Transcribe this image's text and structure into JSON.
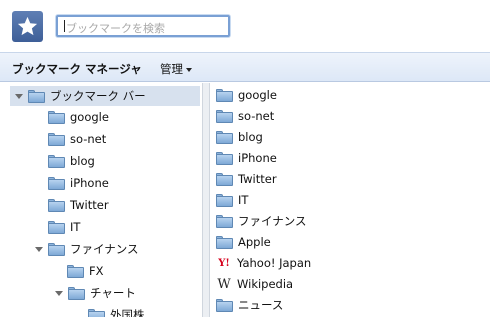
{
  "header": {
    "logo_icon": "star-icon",
    "search_placeholder": "ブックマークを検索"
  },
  "toolbar": {
    "title": "ブックマーク マネージャ",
    "organize_label": "管理"
  },
  "tree": {
    "root": "ブックマーク バー",
    "items": [
      "google",
      "so-net",
      "blog",
      "iPhone",
      "Twitter",
      "IT",
      "ファイナンス",
      "FX",
      "チャート",
      "外国株"
    ]
  },
  "list": {
    "items": [
      {
        "label": "google",
        "icon": "folder-icon"
      },
      {
        "label": "so-net",
        "icon": "folder-icon"
      },
      {
        "label": "blog",
        "icon": "folder-icon"
      },
      {
        "label": "iPhone",
        "icon": "folder-icon"
      },
      {
        "label": "Twitter",
        "icon": "folder-icon"
      },
      {
        "label": "IT",
        "icon": "folder-icon"
      },
      {
        "label": "ファイナンス",
        "icon": "folder-icon"
      },
      {
        "label": "Apple",
        "icon": "folder-icon"
      },
      {
        "label": "Yahoo! Japan",
        "icon": "yahoo-icon"
      },
      {
        "label": "Wikipedia",
        "icon": "wikipedia-icon"
      },
      {
        "label": "ニュース",
        "icon": "folder-icon"
      }
    ]
  },
  "colors": {
    "toolbar_bg": "#dde8f7",
    "selection_bg": "#d7e1ee",
    "folder_blue": "#7ea9d6",
    "yahoo_red": "#d6001c"
  }
}
